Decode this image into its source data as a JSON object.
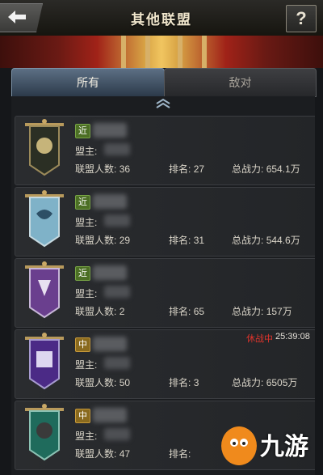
{
  "header": {
    "title": "其他联盟",
    "help_label": "?"
  },
  "tabs": [
    {
      "label": "所有",
      "active": true
    },
    {
      "label": "敌对",
      "active": false
    }
  ],
  "alliances": [
    {
      "badge": "近",
      "leader_label": "盟主:",
      "members_label": "联盟人数:",
      "members": "36",
      "rank_label": "排名:",
      "rank": "27",
      "power_label": "总战力:",
      "power": "654.1万",
      "flag_color": "#2b2f24"
    },
    {
      "badge": "近",
      "leader_label": "盟主:",
      "members_label": "联盟人数:",
      "members": "29",
      "rank_label": "排名:",
      "rank": "31",
      "power_label": "总战力:",
      "power": "544.6万",
      "flag_color": "#7fb2c8"
    },
    {
      "badge": "近",
      "leader_label": "盟主:",
      "members_label": "联盟人数:",
      "members": "2",
      "rank_label": "排名:",
      "rank": "65",
      "power_label": "总战力:",
      "power": "157万",
      "flag_color": "#6a3f8e"
    },
    {
      "badge": "中",
      "leader_label": "盟主:",
      "members_label": "联盟人数:",
      "members": "50",
      "rank_label": "排名:",
      "rank": "3",
      "power_label": "总战力:",
      "power": "6505万",
      "flag_color": "#4b2a86",
      "war_status": "休战中",
      "war_time": "25:39:08"
    },
    {
      "badge": "中",
      "leader_label": "盟主:",
      "members_label": "联盟人数:",
      "members": "47",
      "rank_label": "排名:",
      "rank": "",
      "power_label": "",
      "power": "",
      "flag_color": "#1f6b5c"
    }
  ],
  "watermark": {
    "text": "九游"
  },
  "colors": {
    "accent_tab": "#5c6f84",
    "war_red": "#e0342c",
    "near_badge": "#4c6f25",
    "mid_badge": "#8a6a1e"
  }
}
